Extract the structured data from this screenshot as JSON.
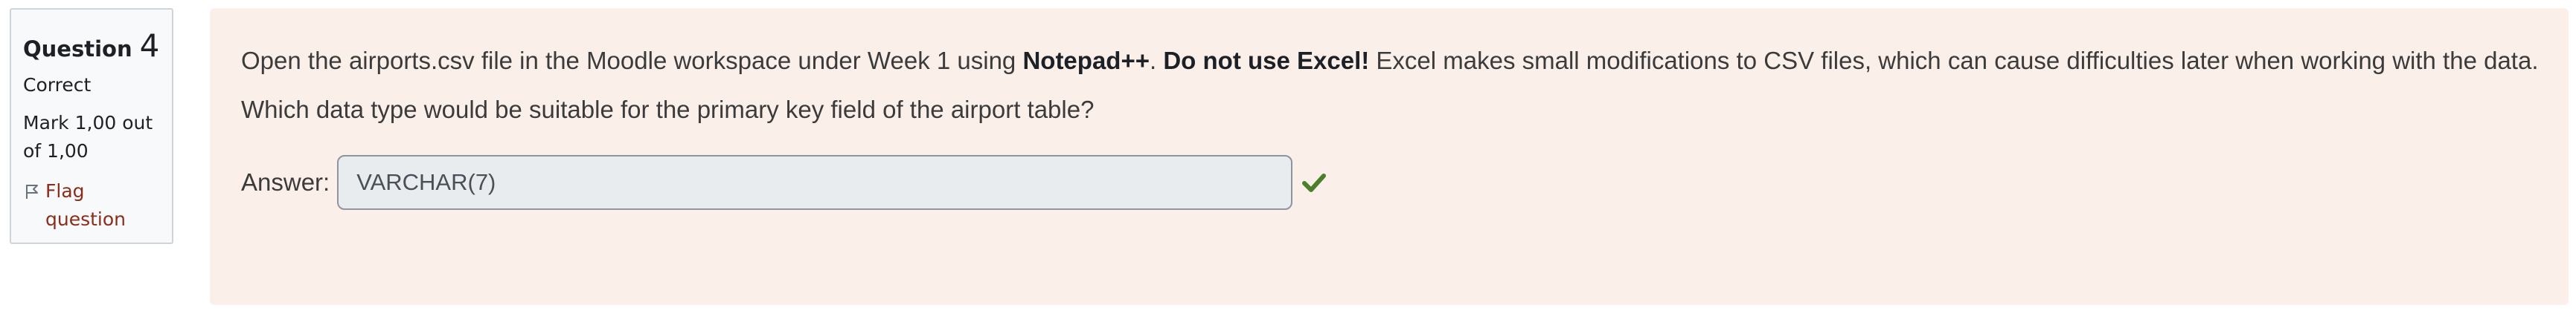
{
  "info": {
    "question_label": "Question",
    "question_number": "4",
    "state": "Correct",
    "grade": "Mark 1,00 out of 1,00",
    "flag_label": "Flag question",
    "flag_icon": "flag-outline-icon"
  },
  "prompt": {
    "part1": "Open the airports.csv file in the Moodle workspace under Week 1 using ",
    "bold1": "Notepad++",
    "part2": ". ",
    "bold2": "Do not use Excel!",
    "part3": " Excel makes small modifications to CSV files, which can cause difficulties later when working with the data.",
    "question": "Which data type would be suitable for the primary key field of the airport table?"
  },
  "answer": {
    "label": "Answer:",
    "value": "VARCHAR(7)",
    "status_icon": "checkmark-icon",
    "status_color": "#4b7f2a"
  },
  "colors": {
    "content_bg": "#fbefea",
    "flag_text": "#8a2d1a"
  }
}
